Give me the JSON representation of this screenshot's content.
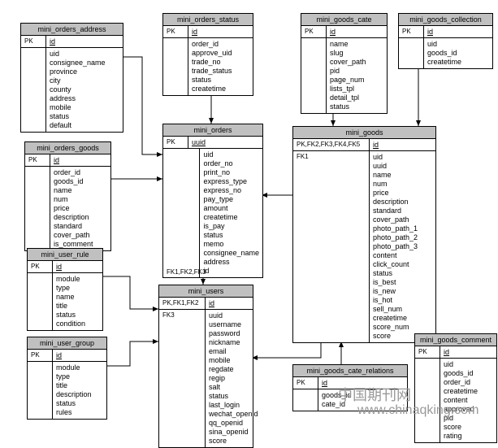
{
  "entities": {
    "orders_address": {
      "title": "mini_orders_address",
      "pk": "PK",
      "id": "id",
      "left": "",
      "fields": [
        "uid",
        "consignee_name",
        "province",
        "city",
        "county",
        "address",
        "mobile",
        "status",
        "default"
      ]
    },
    "orders_status": {
      "title": "mini_orders_status",
      "pk": "PK",
      "id": "id",
      "left": "",
      "fields": [
        "order_id",
        "approve_uid",
        "trade_no",
        "trade_status",
        "status",
        "createtime"
      ]
    },
    "goods_cate": {
      "title": "mini_goods_cate",
      "pk": "PK",
      "id": "id",
      "left": "",
      "fields": [
        "name",
        "slug",
        "cover_path",
        "pid",
        "page_num",
        "lists_tpl",
        "detail_tpl",
        "status"
      ]
    },
    "goods_collection": {
      "title": "mini_goods_collection",
      "pk": "PK",
      "id": "id",
      "left": "",
      "fields": [
        "uid",
        "goods_id",
        "createtime"
      ]
    },
    "orders": {
      "title": "mini_orders",
      "pk": "PK",
      "id": "uuid",
      "left": "FK1,FK2,FK3",
      "fields": [
        "uid",
        "order_no",
        "print_no",
        "express_type",
        "express_no",
        "pay_type",
        "amount",
        "createtime",
        "is_pay",
        "status",
        "memo",
        "consignee_name",
        "address",
        "id"
      ]
    },
    "orders_goods": {
      "title": "mini_orders_goods",
      "pk": "PK",
      "id": "id",
      "left": "",
      "fields": [
        "order_id",
        "goods_id",
        "name",
        "num",
        "price",
        "description",
        "standard",
        "cover_path",
        "is_comment"
      ]
    },
    "goods": {
      "title": "mini_goods",
      "pk": "PK,FK2,FK3,FK4,FK5",
      "id": "id",
      "left": "FK1",
      "fields": [
        "uid",
        "uuid",
        "name",
        "num",
        "price",
        "description",
        "standard",
        "cover_path",
        "photo_path_1",
        "photo_path_2",
        "photo_path_3",
        "content",
        "click_count",
        "status",
        "is_best",
        "is_new",
        "is_hot",
        "sell_num",
        "createtime",
        "score_num",
        "score"
      ]
    },
    "user_rule": {
      "title": "mini_user_rule",
      "pk": "PK",
      "id": "id",
      "left": "",
      "fields": [
        "module",
        "type",
        "name",
        "title",
        "status",
        "condition"
      ]
    },
    "users": {
      "title": "mini_users",
      "pk": "PK,FK1,FK2",
      "id": "id",
      "left": "FK3",
      "fields": [
        "uuid",
        "username",
        "password",
        "nickname",
        "email",
        "mobile",
        "regdate",
        "regip",
        "salt",
        "status",
        "last_login",
        "wechat_openid",
        "qq_openid",
        "sina_openid",
        "score"
      ]
    },
    "user_group": {
      "title": "mini_user_group",
      "pk": "PK",
      "id": "id",
      "left": "",
      "fields": [
        "module",
        "type",
        "title",
        "description",
        "status",
        "rules"
      ]
    },
    "cate_relations": {
      "title": "mini_goods_cate_relations",
      "pk": "PK",
      "id": "id",
      "left": "",
      "fields": [
        "goods_id",
        "cate_id"
      ]
    },
    "goods_comment": {
      "title": "mini_goods_comment",
      "pk": "PK",
      "id": "id",
      "left": "",
      "fields": [
        "uid",
        "goods_id",
        "order_id",
        "createtime",
        "content",
        "approved",
        "pid",
        "score",
        "rating"
      ]
    }
  },
  "watermark1": "中国期刊网",
  "watermark2": "www.chinaqking.com"
}
